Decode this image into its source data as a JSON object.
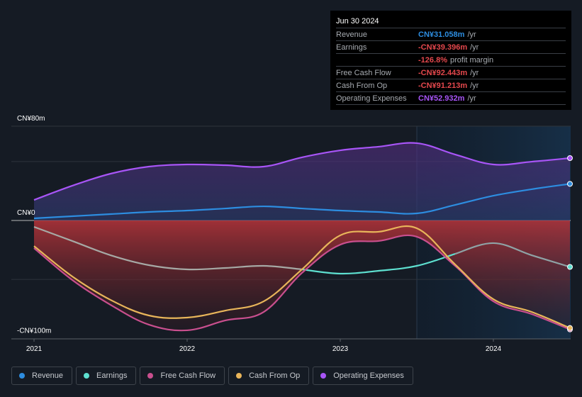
{
  "tooltip": {
    "date": "Jun 30 2024",
    "rows": [
      {
        "label": "Revenue",
        "value": "CN¥31.058m",
        "unit": "/yr",
        "color": "#2d8de0"
      },
      {
        "label": "Earnings",
        "value": "-CN¥39.396m",
        "unit": "/yr",
        "color": "#e5484d"
      },
      {
        "label": "",
        "value": "-126.8%",
        "unit": "profit margin",
        "color": "#e5484d"
      },
      {
        "label": "Free Cash Flow",
        "value": "-CN¥92.443m",
        "unit": "/yr",
        "color": "#e5484d"
      },
      {
        "label": "Cash From Op",
        "value": "-CN¥91.213m",
        "unit": "/yr",
        "color": "#e5484d"
      },
      {
        "label": "Operating Expenses",
        "value": "CN¥52.932m",
        "unit": "/yr",
        "color": "#a855f7"
      }
    ]
  },
  "legend": [
    {
      "label": "Revenue",
      "color": "#2d8de0"
    },
    {
      "label": "Earnings",
      "color": "#5ee0d0"
    },
    {
      "label": "Free Cash Flow",
      "color": "#c94f8e"
    },
    {
      "label": "Cash From Op",
      "color": "#e8b55a"
    },
    {
      "label": "Operating Expenses",
      "color": "#a855f7"
    }
  ],
  "chart_data": {
    "type": "line",
    "title": "",
    "xlabel": "",
    "ylabel": "",
    "y_tick_labels": [
      "CN¥80m",
      "CN¥0",
      "-CN¥100m"
    ],
    "y_ticks": [
      80,
      0,
      -100
    ],
    "ylim": [
      -100,
      80
    ],
    "x_tick_labels": [
      "2021",
      "2022",
      "2023",
      "2024"
    ],
    "x_ticks": [
      2021.0,
      2022.0,
      2023.0,
      2024.0
    ],
    "xlim": [
      2020.85,
      2024.5
    ],
    "grid": true,
    "legend_position": "bottom-left",
    "highlight_from": 2023.5,
    "x": [
      2021.0,
      2021.25,
      2021.5,
      2021.75,
      2022.0,
      2022.25,
      2022.5,
      2022.75,
      2023.0,
      2023.25,
      2023.5,
      2023.75,
      2024.0,
      2024.25,
      2024.5
    ],
    "series": [
      {
        "name": "Revenue",
        "color": "#2d8de0",
        "values": [
          1.8,
          3.6,
          5.4,
          7.2,
          8.4,
          10.2,
          12.0,
          10.2,
          8.4,
          7.2,
          6.0,
          13.2,
          21.0,
          26.5,
          31.058
        ]
      },
      {
        "name": "Earnings",
        "color": "#5ee0d0",
        "values": [
          -5.4,
          -17.4,
          -29.5,
          -37.9,
          -41.5,
          -40.3,
          -38.5,
          -41.5,
          -45.1,
          -42.7,
          -38.5,
          -28.3,
          -19.2,
          -29.5,
          -39.396
        ]
      },
      {
        "name": "Free Cash Flow",
        "color": "#c94f8e",
        "values": [
          -23.5,
          -50.5,
          -71.6,
          -88.4,
          -93.2,
          -84.8,
          -77.6,
          -44.5,
          -20.5,
          -17.4,
          -13.8,
          -38.5,
          -68.6,
          -79.4,
          -92.443
        ]
      },
      {
        "name": "Cash From Op",
        "color": "#e8b55a",
        "values": [
          -21.7,
          -47.5,
          -67.4,
          -80.6,
          -82.4,
          -76.4,
          -68.6,
          -41.5,
          -12.6,
          -9.6,
          -6.6,
          -37.3,
          -66.8,
          -77.6,
          -91.213
        ]
      },
      {
        "name": "Operating Expenses",
        "color": "#a855f7",
        "values": [
          17.4,
          29.5,
          39.7,
          45.7,
          47.5,
          46.9,
          45.7,
          53.6,
          59.5,
          62.6,
          65.6,
          56.0,
          47.5,
          49.9,
          52.932
        ]
      }
    ]
  }
}
